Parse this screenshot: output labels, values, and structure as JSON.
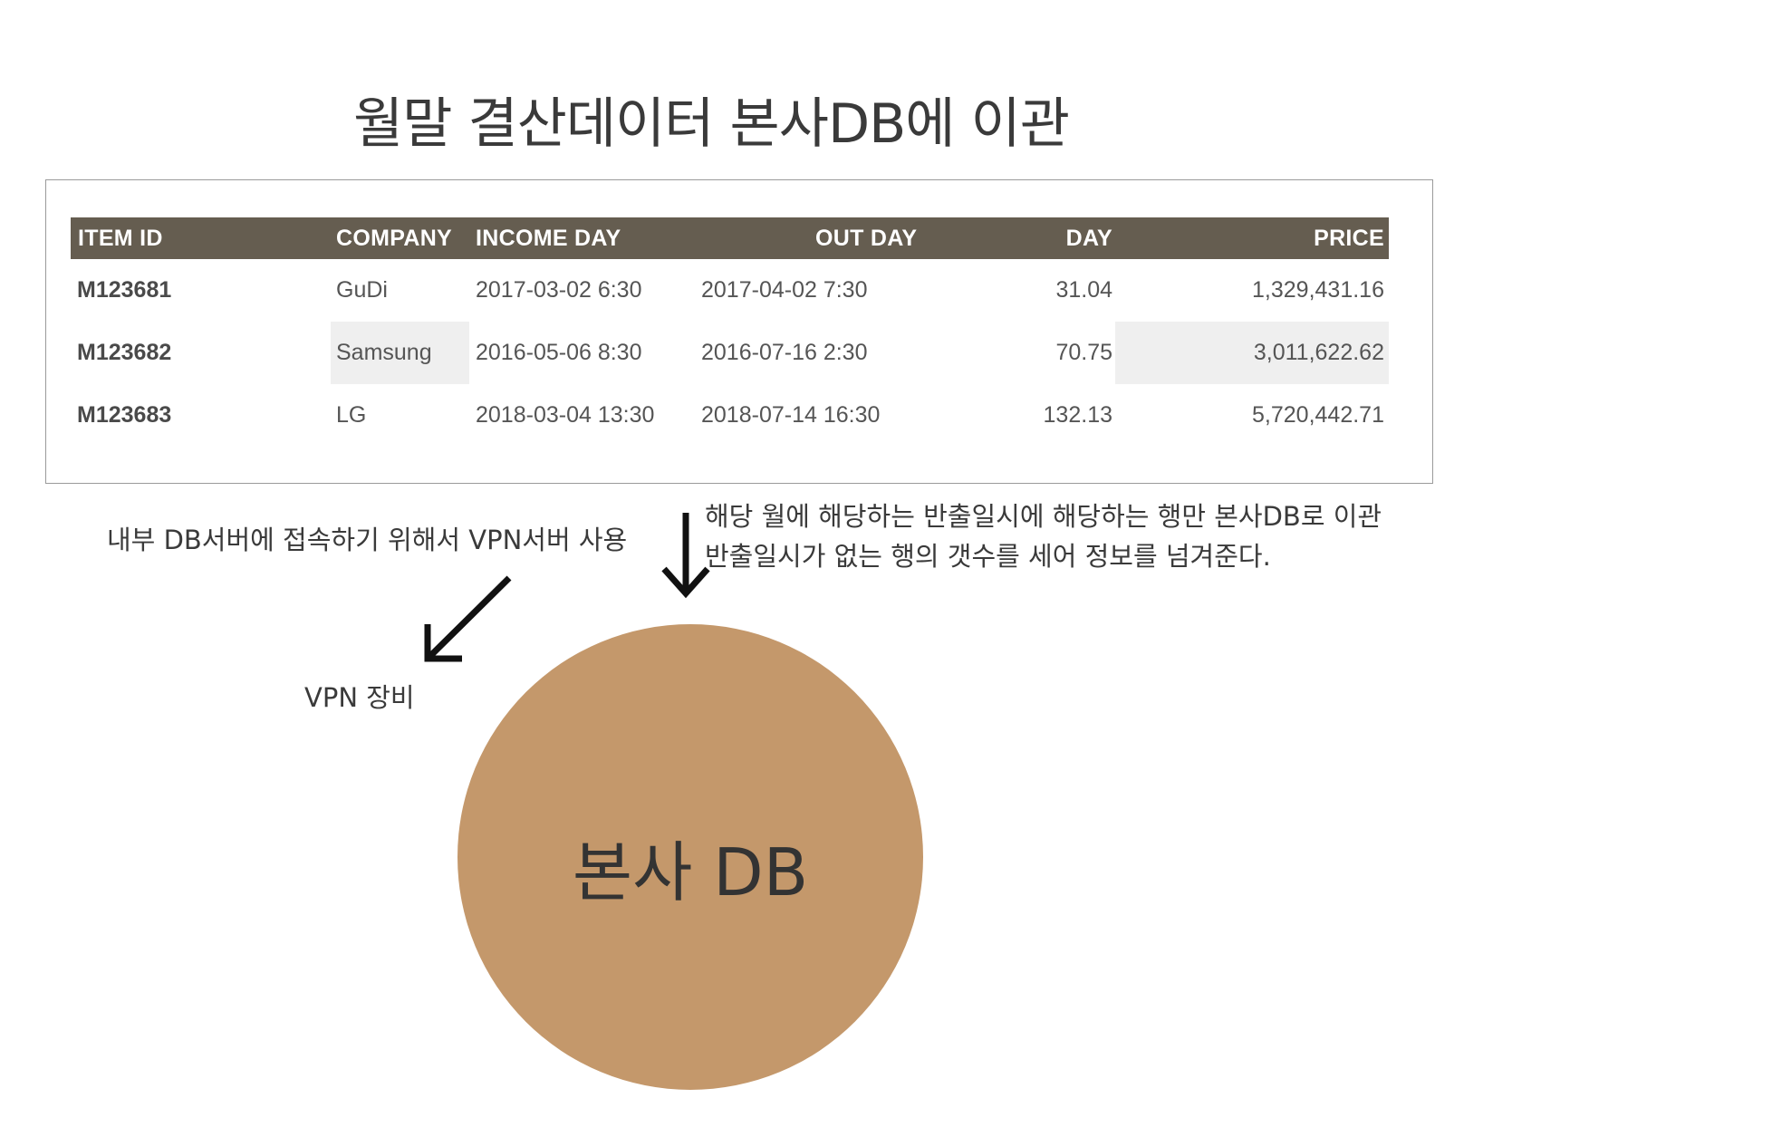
{
  "title": "월말 결산데이터 본사DB에 이관",
  "table": {
    "headers": [
      "ITEM ID",
      "COMPANY",
      "INCOME DAY",
      "OUT DAY",
      "DAY",
      "PRICE"
    ],
    "rows": [
      [
        "M123681",
        "GuDi",
        "2017-03-02 6:30",
        "2017-04-02 7:30",
        "31.04",
        "1,329,431.16"
      ],
      [
        "M123682",
        "Samsung",
        "2016-05-06 8:30",
        "2016-07-16 2:30",
        "70.75",
        "3,011,622.62"
      ],
      [
        "M123683",
        "LG",
        "2018-03-04 13:30",
        "2018-07-14 16:30",
        "132.13",
        "5,720,442.71"
      ]
    ]
  },
  "notes": {
    "vpn_usage": "내부 DB서버에 접속하기 위해서 VPN서버 사용",
    "vpn_device": "VPN 장비",
    "transfer_line1": "해당 월에 해당하는 반출일시에 해당하는 행만 본사DB로 이관",
    "transfer_line2": "반출일시가 없는 행의 갯수를 세어 정보를 넘겨준다."
  },
  "db_node": {
    "label": "본사 DB",
    "fill_color": "#c4986b"
  },
  "colors": {
    "table_header_bg": "#655d50",
    "highlight_cell_bg": "#efefef"
  }
}
